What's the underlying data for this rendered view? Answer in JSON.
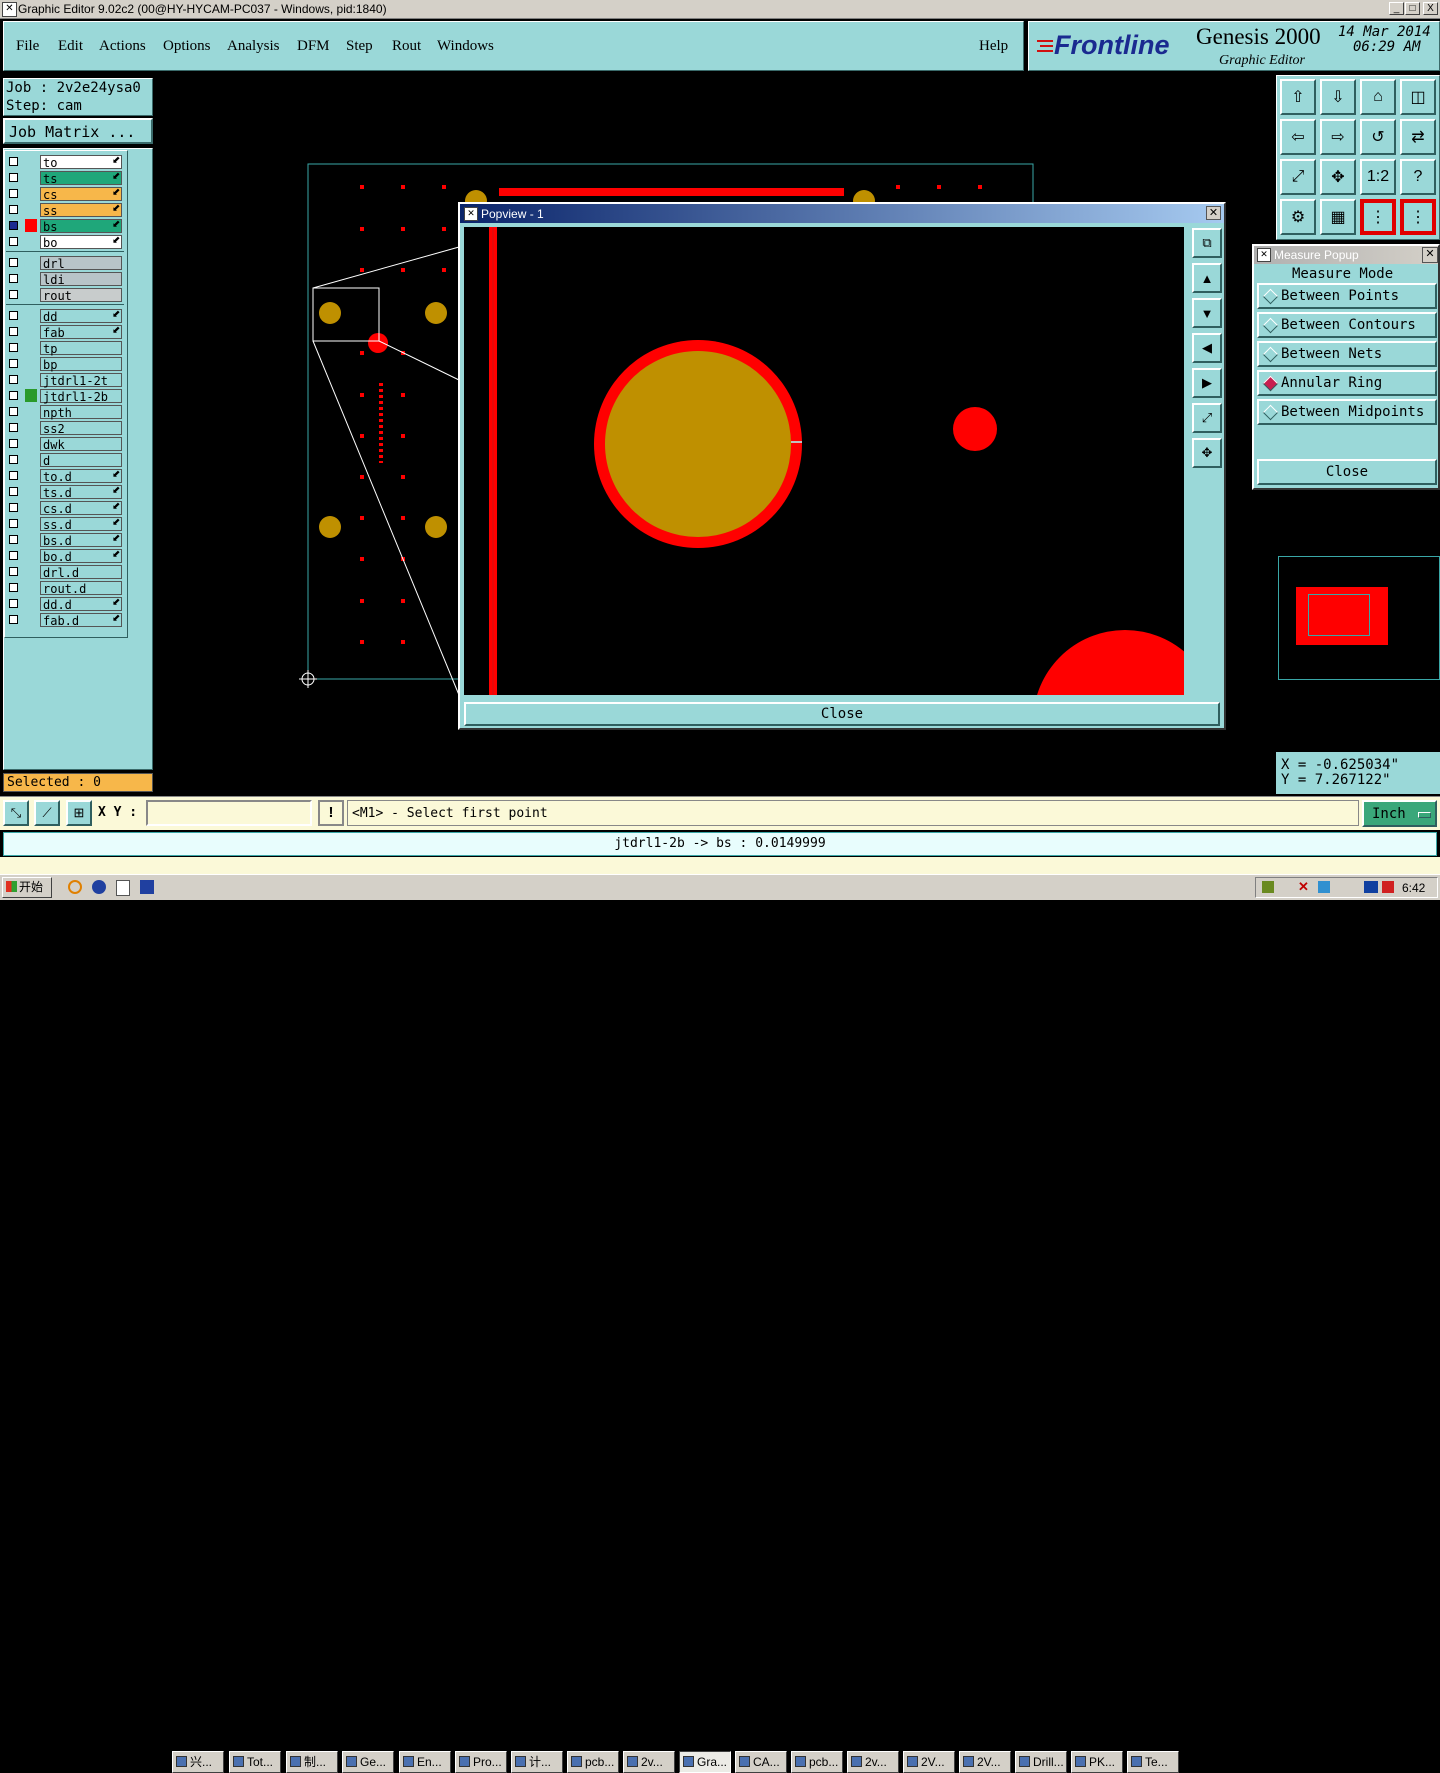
{
  "window": {
    "title": "Graphic Editor 9.02c2 (00@HY-HYCAM-PC037 - Windows, pid:1840)",
    "buttons": [
      "_",
      "□",
      "X"
    ]
  },
  "menu": {
    "items": [
      "File",
      "Edit",
      "Actions",
      "Options",
      "Analysis",
      "DFM",
      "Step",
      "Rout",
      "Windows"
    ],
    "help": "Help"
  },
  "brand": {
    "logo": "Frontline",
    "product": "Genesis 2000",
    "subtitle": "Graphic Editor",
    "date": "14 Mar 2014",
    "time": "06:29 AM"
  },
  "job": {
    "job_label": "Job : 2v2e24ysa0",
    "step_label": "Step: cam",
    "matrix_button": "Job Matrix ..."
  },
  "layers": {
    "group1": [
      {
        "name": "to",
        "color": "#ffffff",
        "tick": "⬋"
      },
      {
        "name": "ts",
        "color": "#1fa77a",
        "tick": "⬋"
      },
      {
        "name": "cs",
        "color": "#f7b74a",
        "tick": "⬋"
      },
      {
        "name": "ss",
        "color": "#f7b74a",
        "tick": "⬋"
      },
      {
        "name": "bs",
        "color": "#1fa77a",
        "tick": "⬋",
        "active": true
      },
      {
        "name": "bo",
        "color": "#ffffff",
        "tick": "⬋"
      }
    ],
    "group2": [
      {
        "name": "drl",
        "color": "#b8c4c8"
      },
      {
        "name": "ldi",
        "color": "#b8c4c8"
      },
      {
        "name": "rout",
        "color": "#c8cccc"
      }
    ],
    "group3": [
      {
        "name": "dd",
        "color": "#9ad8d8",
        "tick": "⬋"
      },
      {
        "name": "fab",
        "color": "#9ad8d8",
        "tick": "⬋"
      },
      {
        "name": "tp",
        "color": "#9ad8d8"
      },
      {
        "name": "bp",
        "color": "#9ad8d8"
      },
      {
        "name": "jtdrl1-2t",
        "color": "#9ad8d8"
      },
      {
        "name": "jtdrl1-2b",
        "color": "#9ad8d8",
        "marker": "#2a9a2a"
      },
      {
        "name": "npth",
        "color": "#9ad8d8"
      },
      {
        "name": "ss2",
        "color": "#9ad8d8"
      },
      {
        "name": "dwk",
        "color": "#9ad8d8"
      },
      {
        "name": "d",
        "color": "#9ad8d8"
      },
      {
        "name": "to.d",
        "color": "#9ad8d8",
        "tick": "⬋"
      },
      {
        "name": "ts.d",
        "color": "#9ad8d8",
        "tick": "⬋"
      },
      {
        "name": "cs.d",
        "color": "#9ad8d8",
        "tick": "⬋"
      },
      {
        "name": "ss.d",
        "color": "#9ad8d8",
        "tick": "⬋"
      },
      {
        "name": "bs.d",
        "color": "#9ad8d8",
        "tick": "⬋"
      },
      {
        "name": "bo.d",
        "color": "#9ad8d8",
        "tick": "⬋"
      },
      {
        "name": "drl.d",
        "color": "#9ad8d8"
      },
      {
        "name": "rout.d",
        "color": "#9ad8d8"
      },
      {
        "name": "dd.d",
        "color": "#9ad8d8",
        "tick": "⬋"
      },
      {
        "name": "fab.d",
        "color": "#9ad8d8",
        "tick": "⬋"
      }
    ],
    "selected": "Selected : 0"
  },
  "popview": {
    "title": "Popview - 1",
    "close_button": "Close"
  },
  "measure": {
    "title": "Measure Popup",
    "mode_label": "Measure Mode",
    "options": [
      "Between Points",
      "Between Contours",
      "Between Nets",
      "Annular Ring",
      "Between Midpoints"
    ],
    "selected_option": "Annular Ring",
    "close_button": "Close"
  },
  "coords": {
    "x": "X = -0.625034\"",
    "y": "Y = 7.267122\""
  },
  "statusbar": {
    "xy_label": "X Y :",
    "xy_value": "",
    "prompt": "<M1> - Select first point",
    "unit": "Inch",
    "result": "jtdrl1-2b -> bs : 0.0149999"
  },
  "taskbar": {
    "start": "开始",
    "items": [
      "兴...",
      "Tot...",
      "制...",
      "Ge...",
      "En...",
      "Pro...",
      "计...",
      "pcb...",
      "2v...",
      "Gra...",
      "CA...",
      "pcb...",
      "2v...",
      "2V...",
      "2V...",
      "Drill...",
      "PK...",
      "Te..."
    ],
    "clock": "6:42"
  },
  "colors": {
    "panel": "#9ad8d8",
    "pad_red": "#ff0000",
    "pad_gold": "#bf9000",
    "outline": "#3aa7a7"
  }
}
